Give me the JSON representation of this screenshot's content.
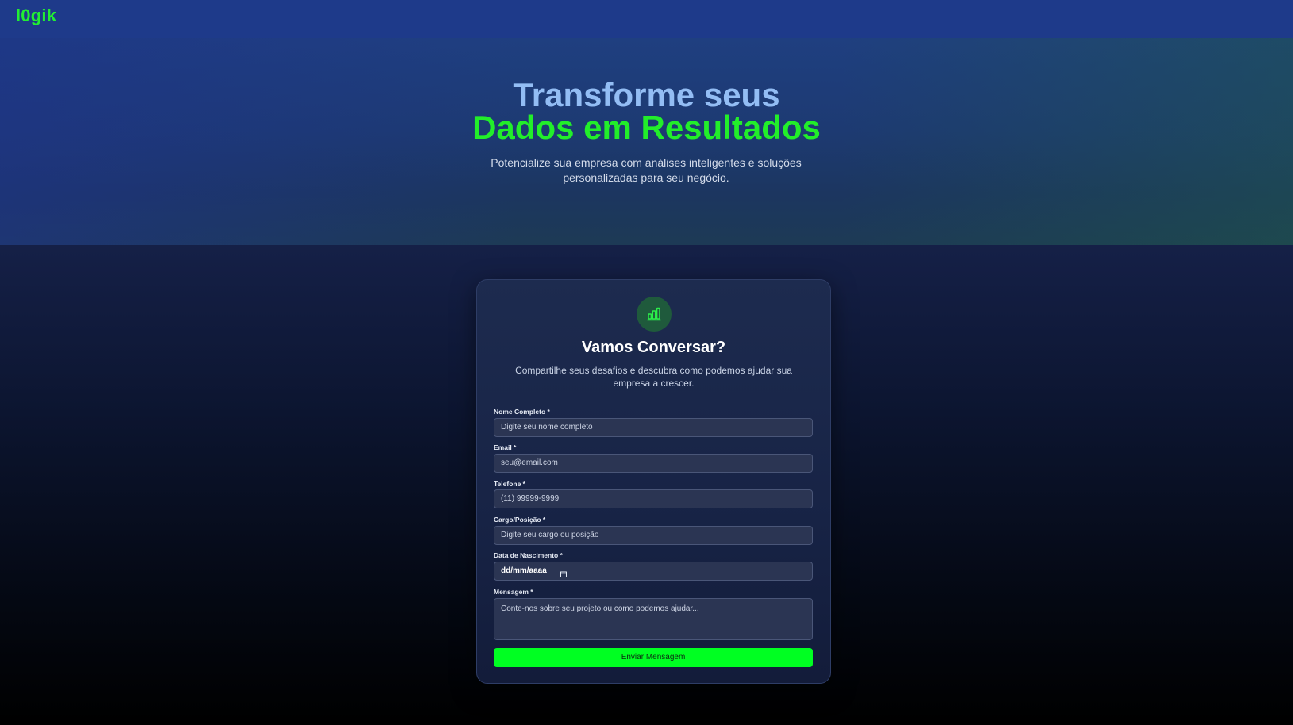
{
  "header": {
    "logo": "l0gik"
  },
  "hero": {
    "title_line1": "Transforme seus",
    "title_line2": "Dados em Resultados",
    "subtitle": "Potencialize sua empresa com análises inteligentes e soluções personalizadas para seu negócio."
  },
  "form": {
    "icon": "bar-chart-icon",
    "title": "Vamos Conversar?",
    "subtitle": "Compartilhe seus desafios e descubra como podemos ajudar sua empresa a crescer.",
    "fields": [
      {
        "label": "Nome Completo *",
        "placeholder": "Digite seu nome completo",
        "value": ""
      },
      {
        "label": "Email *",
        "placeholder": "seu@email.com",
        "value": ""
      },
      {
        "label": "Telefone *",
        "placeholder": "(11) 99999-9999",
        "value": ""
      },
      {
        "label": "Cargo/Posição *",
        "placeholder": "Digite seu cargo ou posição",
        "value": ""
      },
      {
        "label": "Data de Nascimento *",
        "placeholder": "dd/mm/aaaa",
        "value": ""
      },
      {
        "label": "Mensagem *",
        "placeholder": "Conte-nos sobre seu projeto ou como podemos ajudar...",
        "value": ""
      }
    ],
    "submit_label": "Enviar Mensagem"
  },
  "colors": {
    "accent_green": "#00ff22",
    "logo_green": "#22ee33",
    "header_blue": "#1e3a8a",
    "title_blue": "#93bdf4"
  }
}
